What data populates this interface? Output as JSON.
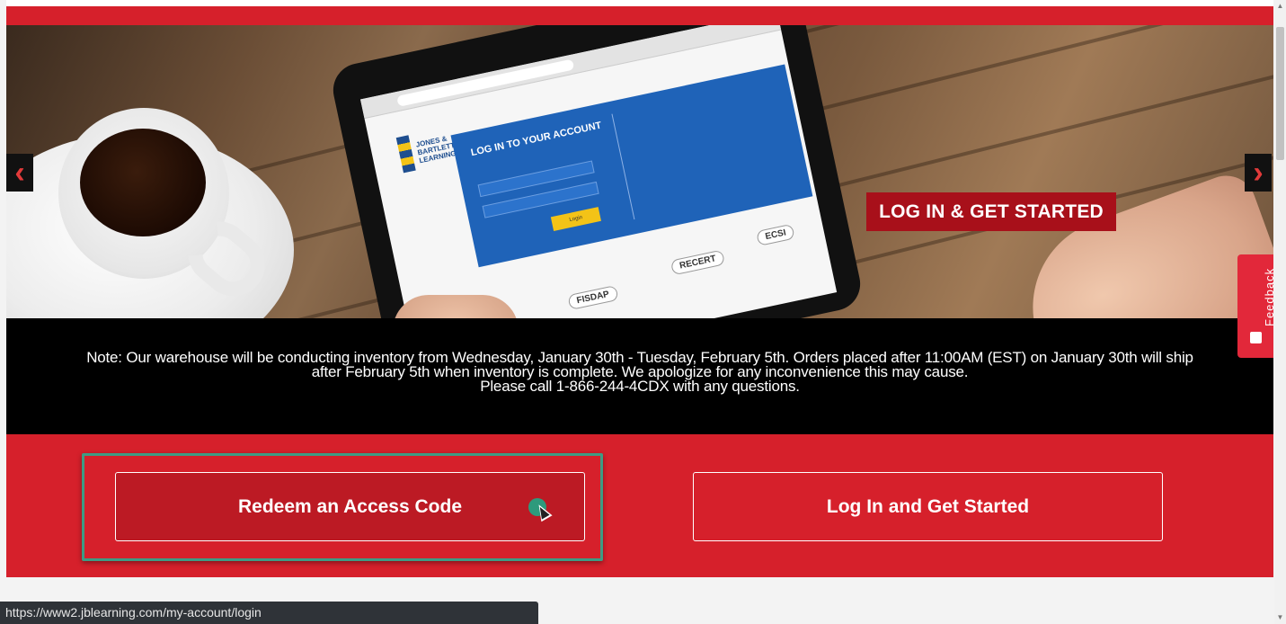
{
  "hero": {
    "cta_label": "LOG IN & GET STARTED",
    "prev_arrow": "‹",
    "next_arrow": "›",
    "tablet": {
      "login_title": "LOG IN TO YOUR ACCOUNT",
      "login_button": "Login",
      "brand_text": "JONES & BARTLETT LEARNING",
      "badges": [
        "FISDAP",
        "RECERT",
        "ECSI"
      ]
    }
  },
  "notice": {
    "line1": "Note: Our warehouse will be conducting inventory from Wednesday, January 30th - Tuesday, February 5th. Orders placed after 11:00AM (EST) on January 30th will ship",
    "line2": "after February 5th when inventory is complete. We apologize for any inconvenience this may cause.",
    "line3": "Please call 1-866-244-4CDX with any questions."
  },
  "actions": {
    "redeem_label": "Redeem an Access Code",
    "login_label": "Log In and Get Started"
  },
  "status_bar": {
    "url": "https://www2.jblearning.com/my-account/login"
  },
  "feedback": {
    "label": "Feedback"
  },
  "colors": {
    "brand_red": "#d6202b",
    "cta_red": "#a8101a",
    "focus_green": "#3e9b84"
  },
  "icons": {
    "prev": "chevron-left-icon",
    "next": "chevron-right-icon",
    "feedback": "feedback-icon"
  }
}
